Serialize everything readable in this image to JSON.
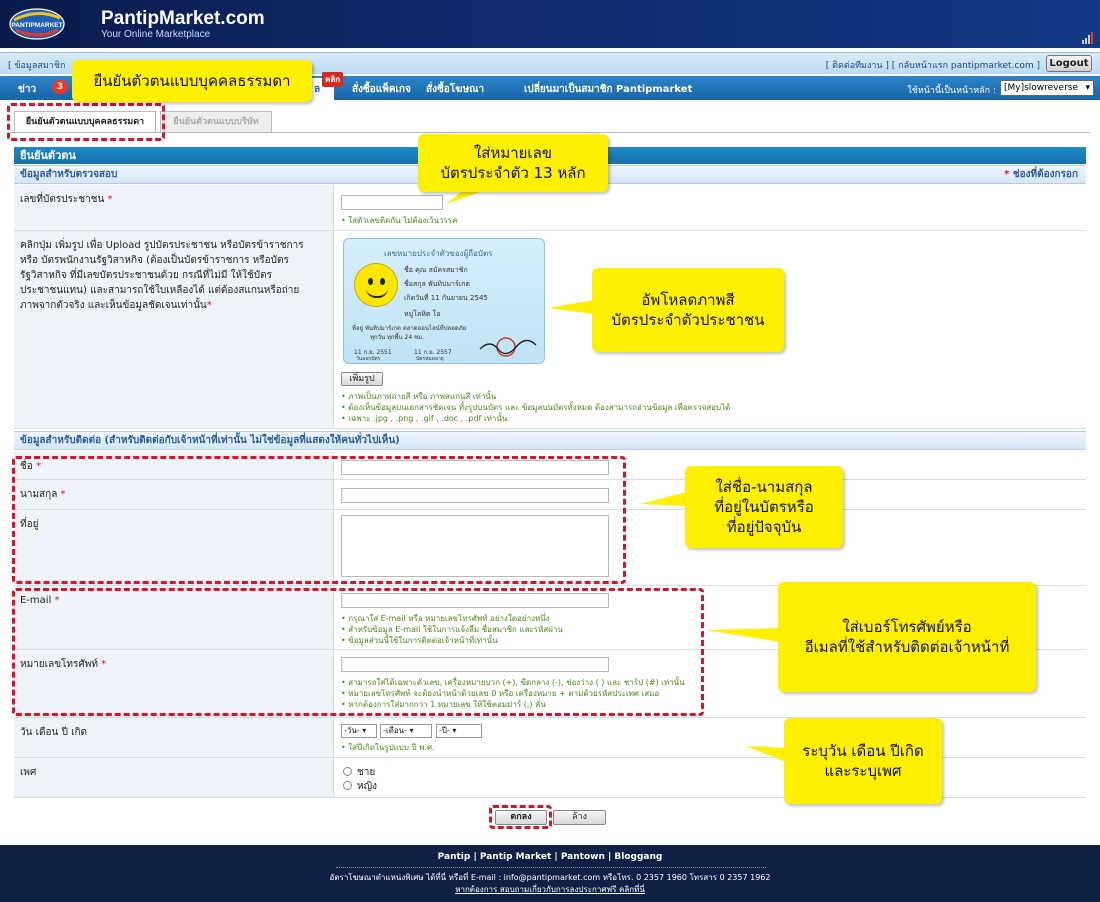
{
  "header": {
    "logo_brand": "PANTIPMARKET",
    "title": "PantipMarket.com",
    "subtitle": "Your Online Marketplace"
  },
  "linkbar": {
    "left_text": "[ ข้อมูลสมาชิก",
    "right_text": "[ ติดต่อทีมงาน ] [ กลับหน้าแรก pantipmarket.com ]",
    "logout_label": "Logout"
  },
  "nav": {
    "items": [
      {
        "label": "ข่าว",
        "badge": "3"
      },
      {
        "label": "ล"
      },
      {
        "label": "สั่งซื้อแพ็คเกจ"
      },
      {
        "label": "สั่งซื้อโฆษณา"
      },
      {
        "label": "เปลี่ยนมาเป็นสมาชิก Pantipmarket"
      }
    ],
    "new_badge": "คลิก",
    "homepage_label": "ใช้หน้านี้เป็นหน้าหลัก :",
    "homepage_value": "[My]slowreverse"
  },
  "callouts": {
    "individual": "ยืนยันตัวตนแบบบุคคลธรรมดา",
    "id_number": "ใส่หมายเลข\nบัตรประจำตัว 13 หลัก",
    "upload": "อัพโหลดภาพสี\nบัตรประจำตัวประชาชน",
    "name_addr": "ใส่ชื่อ-นามสกุล\nที่อยู่ในบัตรหรือ\nที่อยู่ปัจจุบัน",
    "contact": "ใส่เบอร์โทรศัพย์หรือ\nอีเมลที่ใช้สำหรับติดต่อเจ้าหน้าที่",
    "birth": "ระบุวัน เดือน ปีเกิด\nและระบุเพศ"
  },
  "tabs": {
    "individual": "ยืนยันตัวตนแบบบุคคลธรรมดา",
    "company": "ยืนยันตัวตนแบบบริษัท"
  },
  "form": {
    "section_title": "ยืนยันตัวตน",
    "verify_head": "ข้อมูลสำหรับตรวจสอบ",
    "required_note": "ช่องที่ต้องกรอก",
    "required_star": "*",
    "id_label": "เลขที่บัตรประชาชน",
    "id_hint": "• ใส่ตัวเลขติดกัน ไม่ต้องเว้นวรรค",
    "upload_label": "คลิกปุ่ม เพิ่มรูป เพื่อ Upload รูปบัตรประชาชน หรือบัตรข้าราชการ หรือ บัตรพนักงานรัฐวิสาหกิจ (ต้องเป็นบัตรข้าราชการ หรือบัตรรัฐวิสาหกิจ ที่มีเลขบัตรประชาชนด้วย กรณีที่ไม่มี ให้ใช้บัตรประชาชนแทน) และสามารถใช้ใบเหลืองได้ แต่ต้องสแกนหรือถ่ายภาพจากตัวจริง และเห็นข้อมูลชัดเจนเท่านั้น",
    "add_photo": "เพิ่มรูป",
    "upload_hints": [
      "• ภาพเป็นภาพถ่ายสี หรือ ภาพสแกนสี เท่านั้น",
      "• ต้องเห็นข้อมูลบนเอกสารชัดเจน ทั้งรูปบนบัตร และ ข้อมูลบนบัตรทั้งหมด ต้องสามารถอ่านข้อมูล เพื่อตรวจสอบได้",
      "• เฉพาะ .jpg , .png , .gif , .doc , .pdf เท่านั้น"
    ],
    "card": {
      "title": "เลขหมายประจำตัวของผู้ถือบัตร",
      "name": "ชื่อ    คุณ สมัครสมาชิก",
      "surname": "ชื่อสกุล   พันทิปมาร์เกต",
      "born": "เกิดวันที่   11 กันยายน 2545",
      "blood": "หมู่โลหิต   โอ",
      "addr1": "ที่อยู่  พันทิปมาร์เกต ตลาดออนไลน์ที่ปลอดภัย",
      "addr2": "ทุกวัน ทุกพื้น 24 ชม.",
      "issue": "11 ก.ย. 2551",
      "issue_lbl": "วันออกบัตร",
      "expire": "11 ก.ย. 2557",
      "expire_lbl": "บัตรหมดอายุ"
    },
    "contact_head": "ข้อมูลสำหรับติดต่อ (สำหรับติดต่อกับเจ้าหน้าที่เท่านั้น ไม่ใช่ข้อมูลที่แสดงให้คนทั่วไปเห็น)",
    "name_label": "ชื่อ",
    "surname_label": "นามสกุล",
    "address_label": "ที่อยู่",
    "email_label": "E-mail",
    "email_hints": [
      "• กรุณาใส่ E-mail หรือ หมายเลขโทรศัพท์ อย่างใดอย่างหนึ่ง",
      "• สำหรับข้อมูล E-mail ใช้ในการแจ้งลืม ชื่อสมาชิก และรหัสผ่าน",
      "• ข้อมูลส่วนนี้ใช้ในการติดต่อเจ้าหน้าที่เท่านั้น"
    ],
    "phone_label": "หมายเลขโทรศัพท์",
    "phone_hints": [
      "• สามารถใส่ได้เฉพาะตัวเลข, เครื่องหมายบวก (+), ขีดกลาง (-), ช่องว่าง ( ) และ ชาร์ป (#) เท่านั้น",
      "• หมายเลขโทรศัพท์ จะต้องนำหน้าด้วยเลข 0 หรือ เครื่องหมาย + ตามด้วยรหัสประเทศ เสมอ",
      "• หากต้องการใส่มากกว่า 1 หมายเลข ให้ใช้คอมม่าร์ (,) คั่น"
    ],
    "birth_label": "วัน เดือน ปี เกิด",
    "day_sel": "-วัน-",
    "month_sel": "-เดือน-",
    "year_sel": "-ปี-",
    "birth_hint": "• ใส่ปีเกิดในรูปแบบ ปี พ.ศ.",
    "gender_label": "เพศ",
    "male": "ชาย",
    "female": "หญิง",
    "submit": "ตกลง",
    "clear": "ล้าง"
  },
  "footer": {
    "links": "Pantip  |  Pantip Market  |  Pantown  |  Bloggang",
    "contact": "อัตราโฆษณาตำแหน่งพิเศษ ได้ที่นี่ หรือที่ E-mail : info@pantipmarket.com หรือโทร. 0 2357 1960  โทรสาร 0 2357 1962",
    "more": "หากต้องการ สอบถามเกี่ยวกับการลงประกาศฟรี คลิกที่นี่"
  },
  "colors": {
    "callout": "#ffef00",
    "dashed": "#e0102a",
    "nav": "#1765a8",
    "header": "#0d2a6b",
    "hint": "#4d8a1a"
  }
}
